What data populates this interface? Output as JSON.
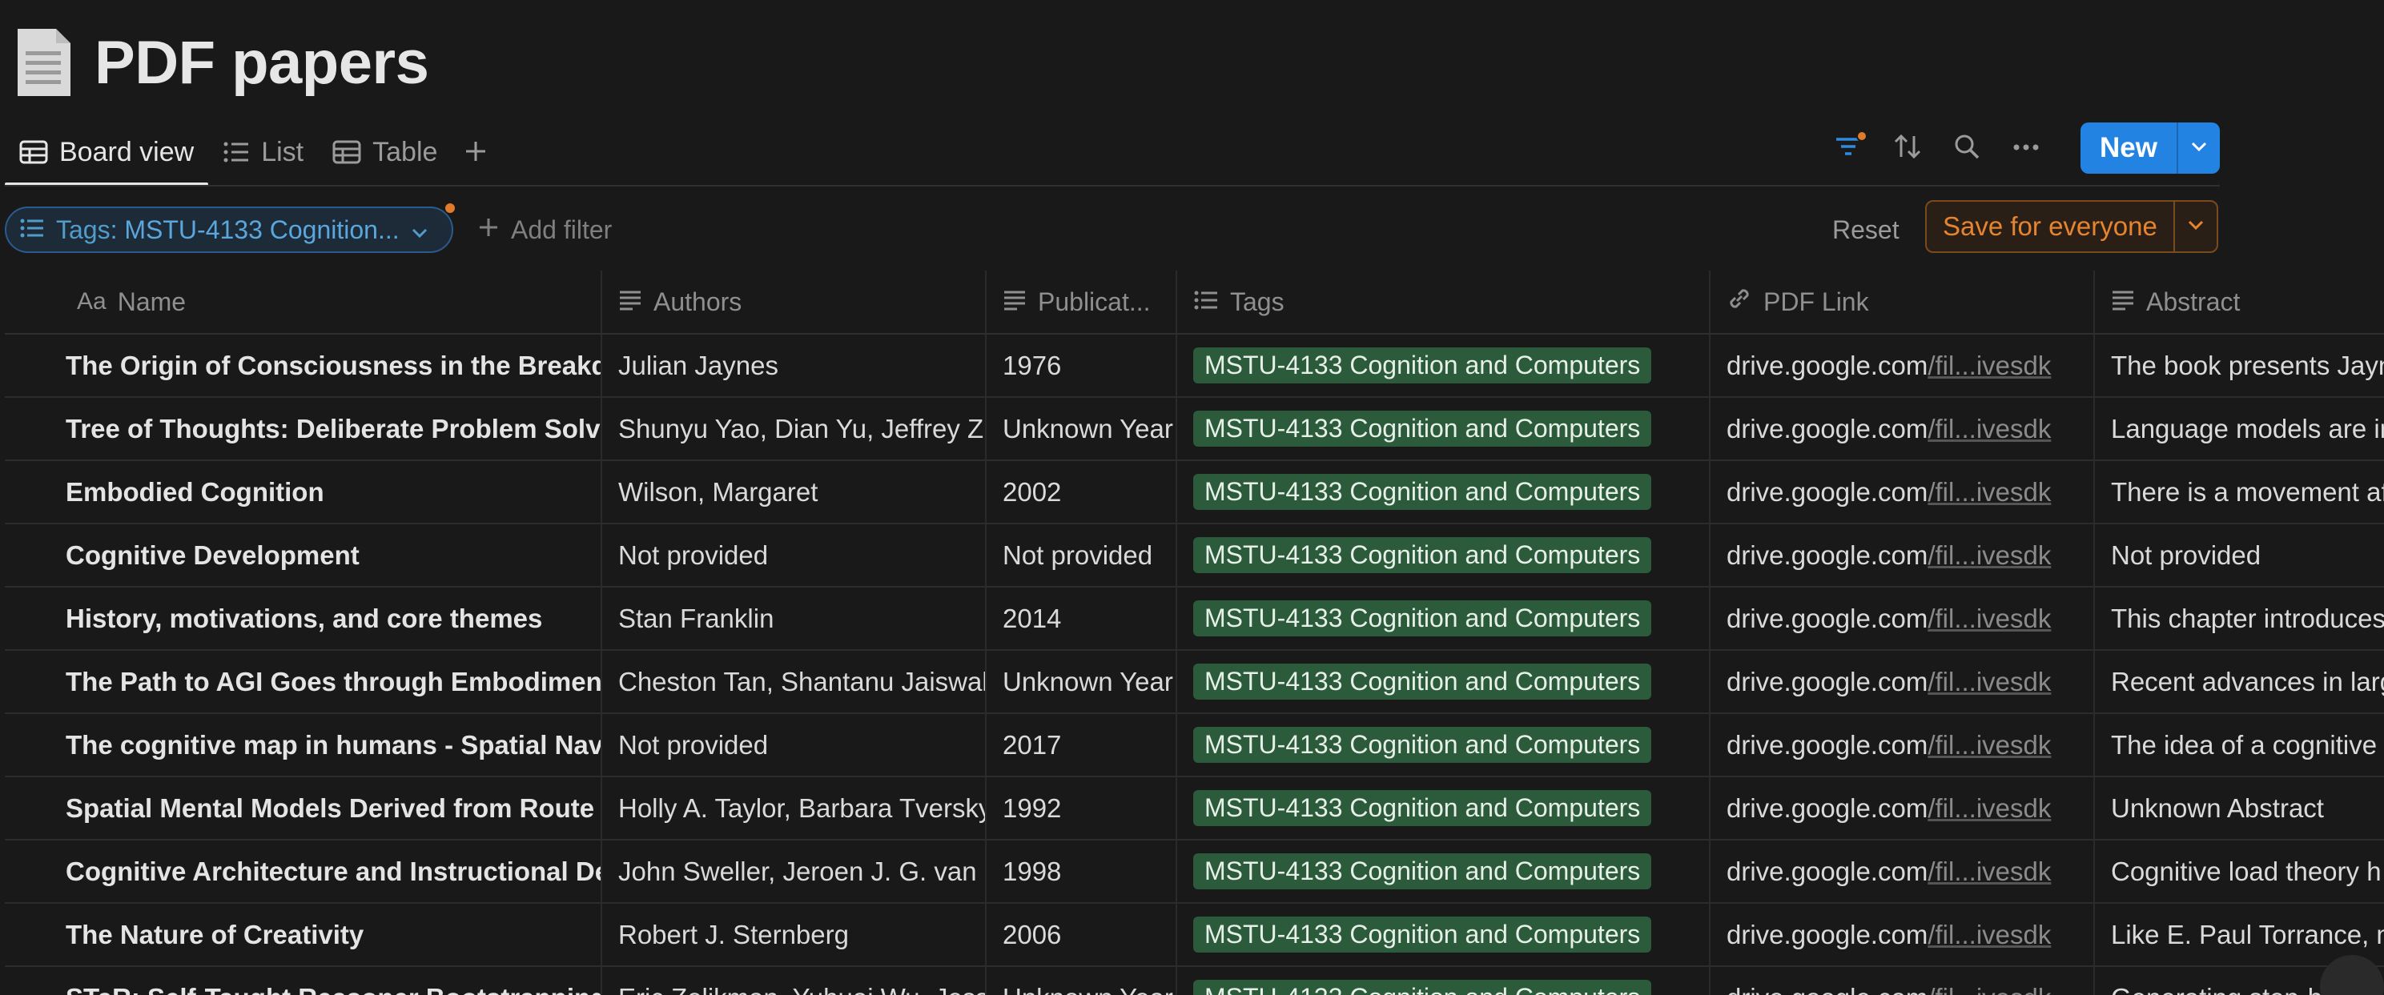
{
  "page": {
    "title": "PDF papers",
    "icon": "document-icon"
  },
  "views": [
    {
      "label": "Board view",
      "icon": "table-icon",
      "active": true
    },
    {
      "label": "List",
      "icon": "list-icon",
      "active": false
    },
    {
      "label": "Table",
      "icon": "table-icon",
      "active": false
    }
  ],
  "toolbar": {
    "new_label": "New"
  },
  "filter": {
    "chip_key": "Tags",
    "chip_value": ": MSTU-4133 Cognition...",
    "add_filter_label": "Add filter",
    "reset_label": "Reset",
    "save_label": "Save for everyone"
  },
  "columns": [
    {
      "label": "Name",
      "icon": "Aa"
    },
    {
      "label": "Authors",
      "icon": "text-icon"
    },
    {
      "label": "Publicat...",
      "icon": "text-icon"
    },
    {
      "label": "Tags",
      "icon": "list-icon"
    },
    {
      "label": "PDF Link",
      "icon": "link-icon"
    },
    {
      "label": "Abstract",
      "icon": "text-icon"
    }
  ],
  "rows": [
    {
      "name": "The Origin of Consciousness in the Breakdow",
      "authors": "Julian Jaynes",
      "pub": "1976",
      "tag": "MSTU-4133 Cognition and Computers",
      "host": "drive.google.com",
      "path": "/fil...ivesdk",
      "abstract": "The book presents Jayn"
    },
    {
      "name": "Tree of Thoughts: Deliberate Problem Solving",
      "authors": "Shunyu Yao, Dian Yu, Jeffrey Zha",
      "pub": "Unknown Year",
      "tag": "MSTU-4133 Cognition and Computers",
      "host": "drive.google.com",
      "path": "/fil...ivesdk",
      "abstract": "Language models are in"
    },
    {
      "name": "Embodied Cognition",
      "authors": "Wilson, Margaret",
      "pub": "2002",
      "tag": "MSTU-4133 Cognition and Computers",
      "host": "drive.google.com",
      "path": "/fil...ivesdk",
      "abstract": "There is a movement af"
    },
    {
      "name": "Cognitive Development",
      "authors": "Not provided",
      "pub": "Not provided",
      "tag": "MSTU-4133 Cognition and Computers",
      "host": "drive.google.com",
      "path": "/fil...ivesdk",
      "abstract": "Not provided"
    },
    {
      "name": "History, motivations, and core themes",
      "authors": "Stan Franklin",
      "pub": "2014",
      "tag": "MSTU-4133 Cognition and Computers",
      "host": "drive.google.com",
      "path": "/fil...ivesdk",
      "abstract": "This chapter introduces"
    },
    {
      "name": "The Path to AGI Goes through Embodiment",
      "authors": "Cheston Tan, Shantanu Jaiswal",
      "pub": "Unknown Year",
      "tag": "MSTU-4133 Cognition and Computers",
      "host": "drive.google.com",
      "path": "/fil...ivesdk",
      "abstract": "Recent advances in larg"
    },
    {
      "name": "The cognitive map in humans - Spatial Navig",
      "authors": "Not provided",
      "pub": "2017",
      "tag": "MSTU-4133 Cognition and Computers",
      "host": "drive.google.com",
      "path": "/fil...ivesdk",
      "abstract": "The idea of a cognitive"
    },
    {
      "name": "Spatial Mental Models Derived from Route a",
      "authors": "Holly A. Taylor, Barbara Tversky",
      "pub": "1992",
      "tag": "MSTU-4133 Cognition and Computers",
      "host": "drive.google.com",
      "path": "/fil...ivesdk",
      "abstract": "Unknown Abstract"
    },
    {
      "name": "Cognitive Architecture and Instructional Des",
      "authors": "John Sweller, Jeroen J. G. van M",
      "pub": "1998",
      "tag": "MSTU-4133 Cognition and Computers",
      "host": "drive.google.com",
      "path": "/fil...ivesdk",
      "abstract": "Cognitive load theory h"
    },
    {
      "name": "The Nature of Creativity",
      "authors": "Robert J. Sternberg",
      "pub": "2006",
      "tag": "MSTU-4133 Cognition and Computers",
      "host": "drive.google.com",
      "path": "/fil...ivesdk",
      "abstract": "Like E. Paul Torrance, my"
    },
    {
      "name": "STaR: Self-Taught Reasoner Bootstrapping Re",
      "authors": "Eric Zelikman, Yuhuai Wu, Jesse",
      "pub": "Unknown Year",
      "tag": "MSTU-4133 Cognition and Computers",
      "host": "drive.google.com",
      "path": "/fil...ivesdk",
      "abstract": "Generating step-by-ste"
    }
  ]
}
